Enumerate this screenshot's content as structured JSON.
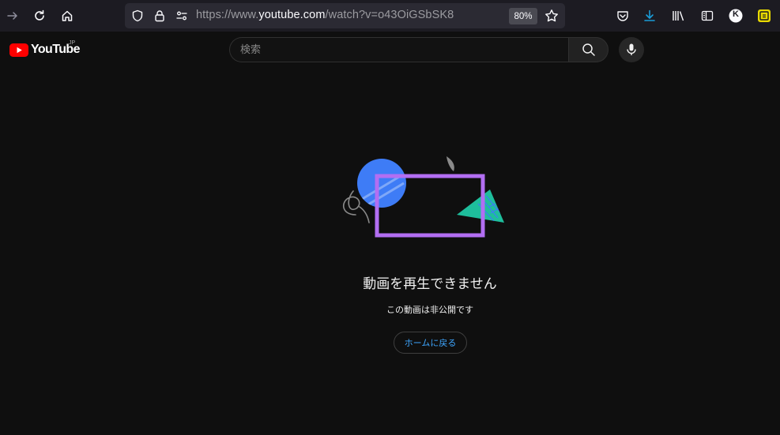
{
  "browser": {
    "url_prefix": "https://www.",
    "url_host": "youtube.com",
    "url_path": "/watch?v=o43OiGSbSK8",
    "zoom": "80%",
    "profile_initial": "K"
  },
  "masthead": {
    "logo_text": "YouTube",
    "region": "JP",
    "search_placeholder": "検索"
  },
  "error": {
    "title": "動画を再生できません",
    "subtitle": "この動画は非公開です",
    "home_button": "ホームに戻る"
  },
  "colors": {
    "accent_link": "#3ea6ff",
    "youtube_red": "#ff0000",
    "illustration_blue": "#3e7cf6",
    "illustration_purple": "#b26ef2",
    "illustration_teal": "#1ebe9c",
    "download_icon": "#1a9dd8"
  }
}
